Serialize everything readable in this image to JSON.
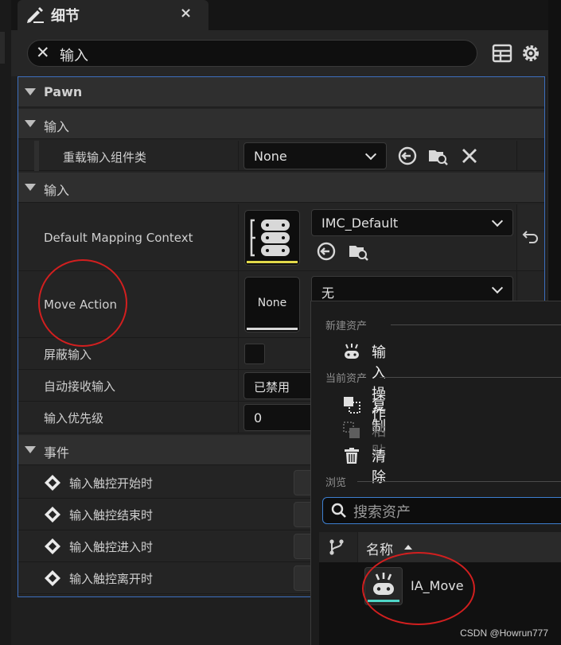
{
  "tab": {
    "title": "细节",
    "close": "×"
  },
  "search": {
    "value": "输入",
    "clear": "✕"
  },
  "toolbar": {
    "table_icon": "table-view-icon",
    "settings_icon": "gear-icon"
  },
  "categories": {
    "pawn": "Pawn",
    "input1": "输入",
    "input2": "输入",
    "events": "事件"
  },
  "props": {
    "override_input_component": {
      "label": "重载输入组件类",
      "value": "None"
    },
    "default_mapping_context": {
      "label": "Default Mapping Context",
      "value": "IMC_Default"
    },
    "move_action": {
      "label": "Move Action",
      "value": "无",
      "thumb_text": "None"
    },
    "block_input": {
      "label": "屏蔽输入"
    },
    "auto_receive_input": {
      "label": "自动接收输入",
      "value": "已禁用"
    },
    "input_priority": {
      "label": "输入优先级",
      "value": "0"
    }
  },
  "events": [
    {
      "label": "输入触控开始时"
    },
    {
      "label": "输入触控结束时"
    },
    {
      "label": "输入触控进入时"
    },
    {
      "label": "输入触控离开时"
    }
  ],
  "popup": {
    "section_new": "新建资产",
    "item_input_action": "输入操作",
    "section_current": "当前资产",
    "item_copy": "复制",
    "item_paste": "粘贴",
    "item_clear": "清除",
    "section_browse": "浏览",
    "search_placeholder": "搜索资产",
    "column_name": "名称",
    "asset": "IA_Move"
  },
  "watermark": "CSDN @Howrun777",
  "colors": {
    "accent": "#3d6fbf",
    "annotation": "#d21f1f",
    "asset_bar": "#4fd6c8",
    "context_bar": "#e2d94a"
  }
}
